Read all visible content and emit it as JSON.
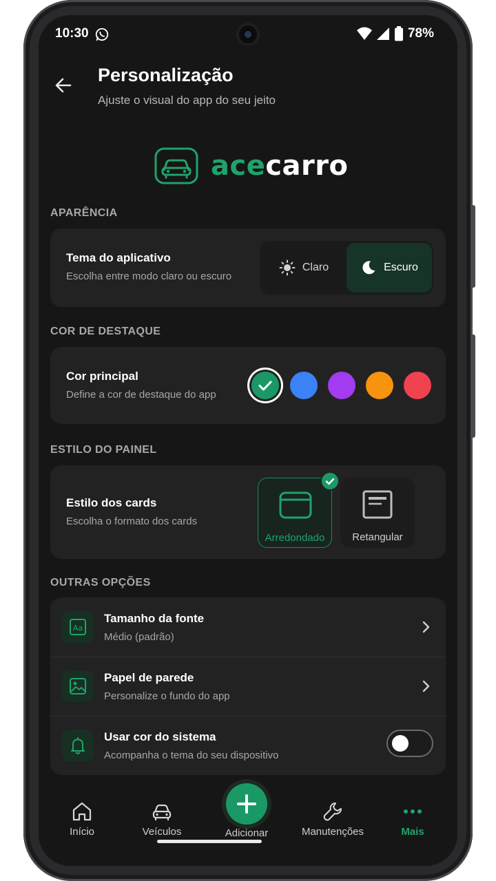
{
  "status_bar": {
    "time": "10:30",
    "battery": "78%"
  },
  "header": {
    "title": "Personalização",
    "subtitle": "Ajuste o visual do app do seu jeito"
  },
  "logo": {
    "part1": "ace",
    "part2": "carro"
  },
  "appearance": {
    "section": "APARÊNCIA",
    "title": "Tema do aplicativo",
    "subtitle": "Escolha entre modo claro ou escuro",
    "options": [
      {
        "label": "Claro",
        "icon": "sun-icon",
        "selected": false
      },
      {
        "label": "Escuro",
        "icon": "moon-icon",
        "selected": true
      }
    ]
  },
  "accent": {
    "section": "COR DE DESTAQUE",
    "title": "Cor principal",
    "subtitle": "Define a cor de destaque do app",
    "colors": [
      "#1a9966",
      "#3b82f6",
      "#a33bf0",
      "#f7930f",
      "#f0424f"
    ],
    "selected_index": 0
  },
  "panel_style": {
    "section": "ESTILO DO PAINEL",
    "title": "Estilo dos cards",
    "subtitle": "Escolha o formato dos cards",
    "options": [
      {
        "label": "Arredondado",
        "selected": true
      },
      {
        "label": "Retangular",
        "selected": false
      }
    ]
  },
  "other": {
    "section": "OUTRAS OPÇÕES",
    "items": [
      {
        "title": "Tamanho da fonte",
        "subtitle": "Médio (padrão)",
        "icon": "font-size-icon",
        "control": "chevron"
      },
      {
        "title": "Papel de parede",
        "subtitle": "Personalize o fundo do app",
        "icon": "image-icon",
        "control": "chevron"
      },
      {
        "title": "Usar cor do sistema",
        "subtitle": "Acompanha o tema do seu dispositivo",
        "icon": "bell-icon",
        "control": "toggle",
        "toggle_on": false
      }
    ]
  },
  "nav": {
    "items": [
      {
        "label": "Início",
        "icon": "home-icon",
        "active": false
      },
      {
        "label": "Veículos",
        "icon": "car-icon",
        "active": false
      },
      {
        "label": "Adicionar",
        "icon": "plus-icon",
        "active": false
      },
      {
        "label": "Manutenções",
        "icon": "wrench-icon",
        "active": false
      },
      {
        "label": "Mais",
        "icon": "more-dots-icon",
        "active": true
      }
    ]
  },
  "colors": {
    "accent": "#1fa36b",
    "background": "#161616",
    "card": "#222223"
  }
}
